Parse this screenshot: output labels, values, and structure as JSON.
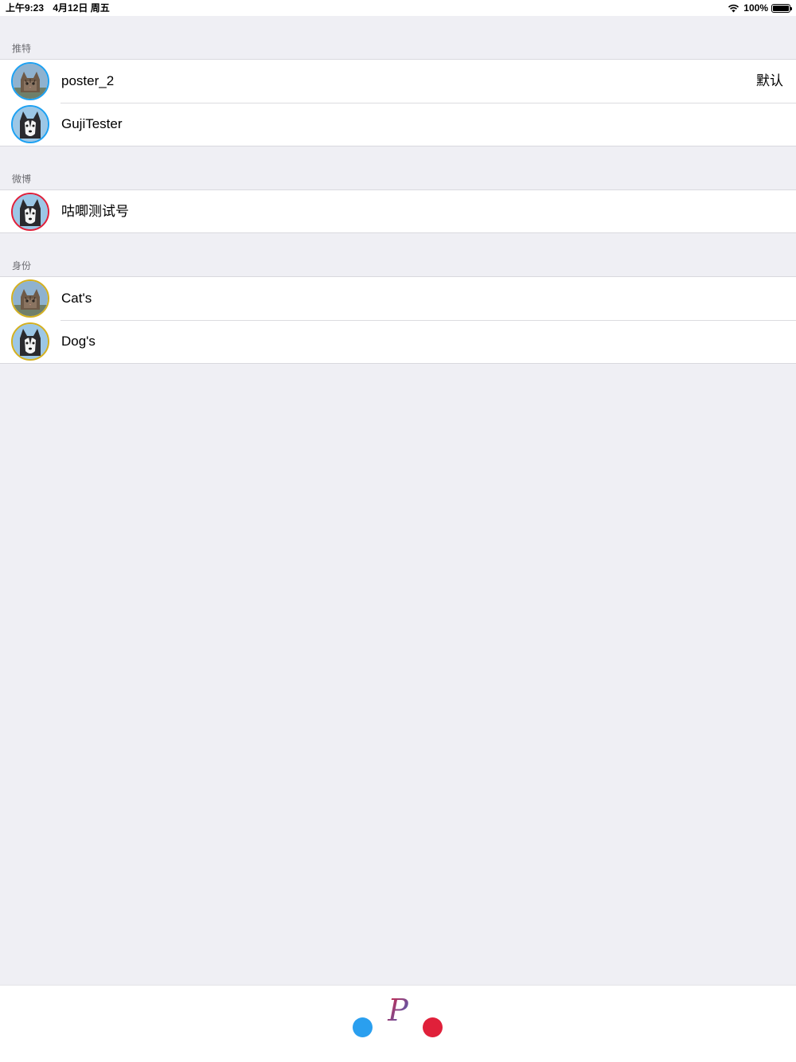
{
  "status_bar": {
    "time": "上午9:23",
    "date": "4月12日 周五",
    "battery": "100%",
    "wifi_icon": "wifi-icon",
    "battery_icon": "battery-icon"
  },
  "sections": [
    {
      "header": "推特",
      "accent": "#1da1f2",
      "accounts": [
        {
          "name": "poster_2",
          "detail": "默认",
          "avatar": "cat"
        },
        {
          "name": "GujiTester",
          "detail": "",
          "avatar": "dog"
        }
      ]
    },
    {
      "header": "微博",
      "accent": "#e0203a",
      "accounts": [
        {
          "name": "咕唧测试号",
          "detail": "",
          "avatar": "dog"
        }
      ]
    },
    {
      "header": "身份",
      "accent": "#d4b020",
      "accounts": [
        {
          "name": "Cat's",
          "detail": "",
          "avatar": "cat"
        },
        {
          "name": "Dog's",
          "detail": "",
          "avatar": "dog"
        }
      ]
    }
  ],
  "bottom_bar": {
    "logo_letter": "P",
    "blue_dot_color": "#2a9fef",
    "red_dot_color": "#e0203a"
  }
}
